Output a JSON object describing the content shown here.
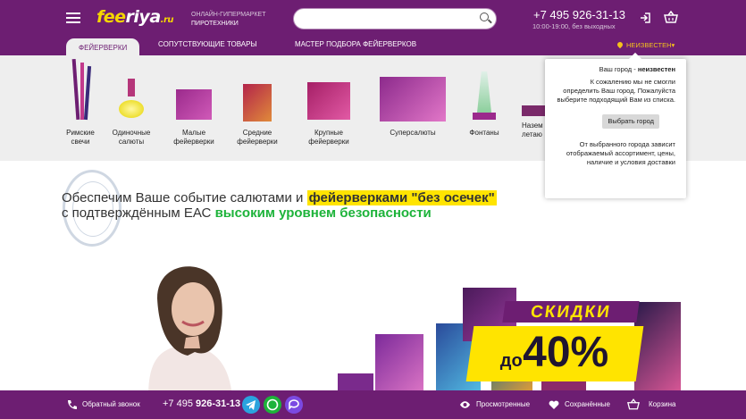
{
  "header": {
    "logo": {
      "part1": "fee",
      "part2": "riya",
      "suffix": ".ru"
    },
    "tagline": {
      "line1": "ОНЛАЙН-ГИПЕРМАРКЕТ",
      "line2": "ПИРОТЕХНИКИ"
    },
    "search": {
      "placeholder": ""
    },
    "phone": "+7 495 926-31-13",
    "hours": "10:00-19:00, без выходных",
    "icons": [
      "menu-icon",
      "search-icon",
      "login-icon",
      "basket-icon"
    ]
  },
  "tabs": [
    {
      "label": "ФЕЙЕРВЕРКИ",
      "active": true
    },
    {
      "label": "СОПУТСТВУЮЩИЕ ТОВАРЫ",
      "active": false
    },
    {
      "label": "МАСТЕР ПОДБОРА ФЕЙЕРВЕРКОВ",
      "active": false
    }
  ],
  "city": {
    "label": "НЕИЗВЕСТЕН"
  },
  "categories": [
    {
      "label1": "Римские",
      "label2": "свечи"
    },
    {
      "label1": "Одиночные",
      "label2": "салюты"
    },
    {
      "label1": "Малые",
      "label2": "фейерверки"
    },
    {
      "label1": "Средние",
      "label2": "фейерверки"
    },
    {
      "label1": "Крупные",
      "label2": "фейерверки"
    },
    {
      "label1": "Суперсалюты",
      "label2": ""
    },
    {
      "label1": "Фонтаны",
      "label2": ""
    },
    {
      "label1": "Назем",
      "label2": "летаю"
    }
  ],
  "popup": {
    "line1_prefix": "Ваш город - ",
    "line1_city": "неизвестен",
    "text1": "К сожалению мы не смогли определить Ваш город. Пожалуйста выберите подходящий Вам из списка.",
    "button": "Выбрать город",
    "text2": "От выбранного города зависит отображаемый ассортимент, цены, наличие и условия доставки"
  },
  "hero": {
    "line1_pre": "Обеспечим Ваше событие салютами и ",
    "line1_hl": "фейерверками \"без осечек\"",
    "line2_pre": "с подтверждённым ЕАС ",
    "line2_hl": "высоким уровнем безопасности",
    "sale_top": "СКИДКИ",
    "sale_do": "до",
    "sale_pct": "40%"
  },
  "footer": {
    "callback": "Обратный звонок",
    "phone_prefix": "+7 495 ",
    "phone_main": "926-31-13",
    "viewed": "Просмотренные",
    "saved": "Сохранённые",
    "basket": "Корзина"
  },
  "colors": {
    "brand": "#6d1e72",
    "accent": "#f5d600",
    "green": "#1db33a"
  }
}
